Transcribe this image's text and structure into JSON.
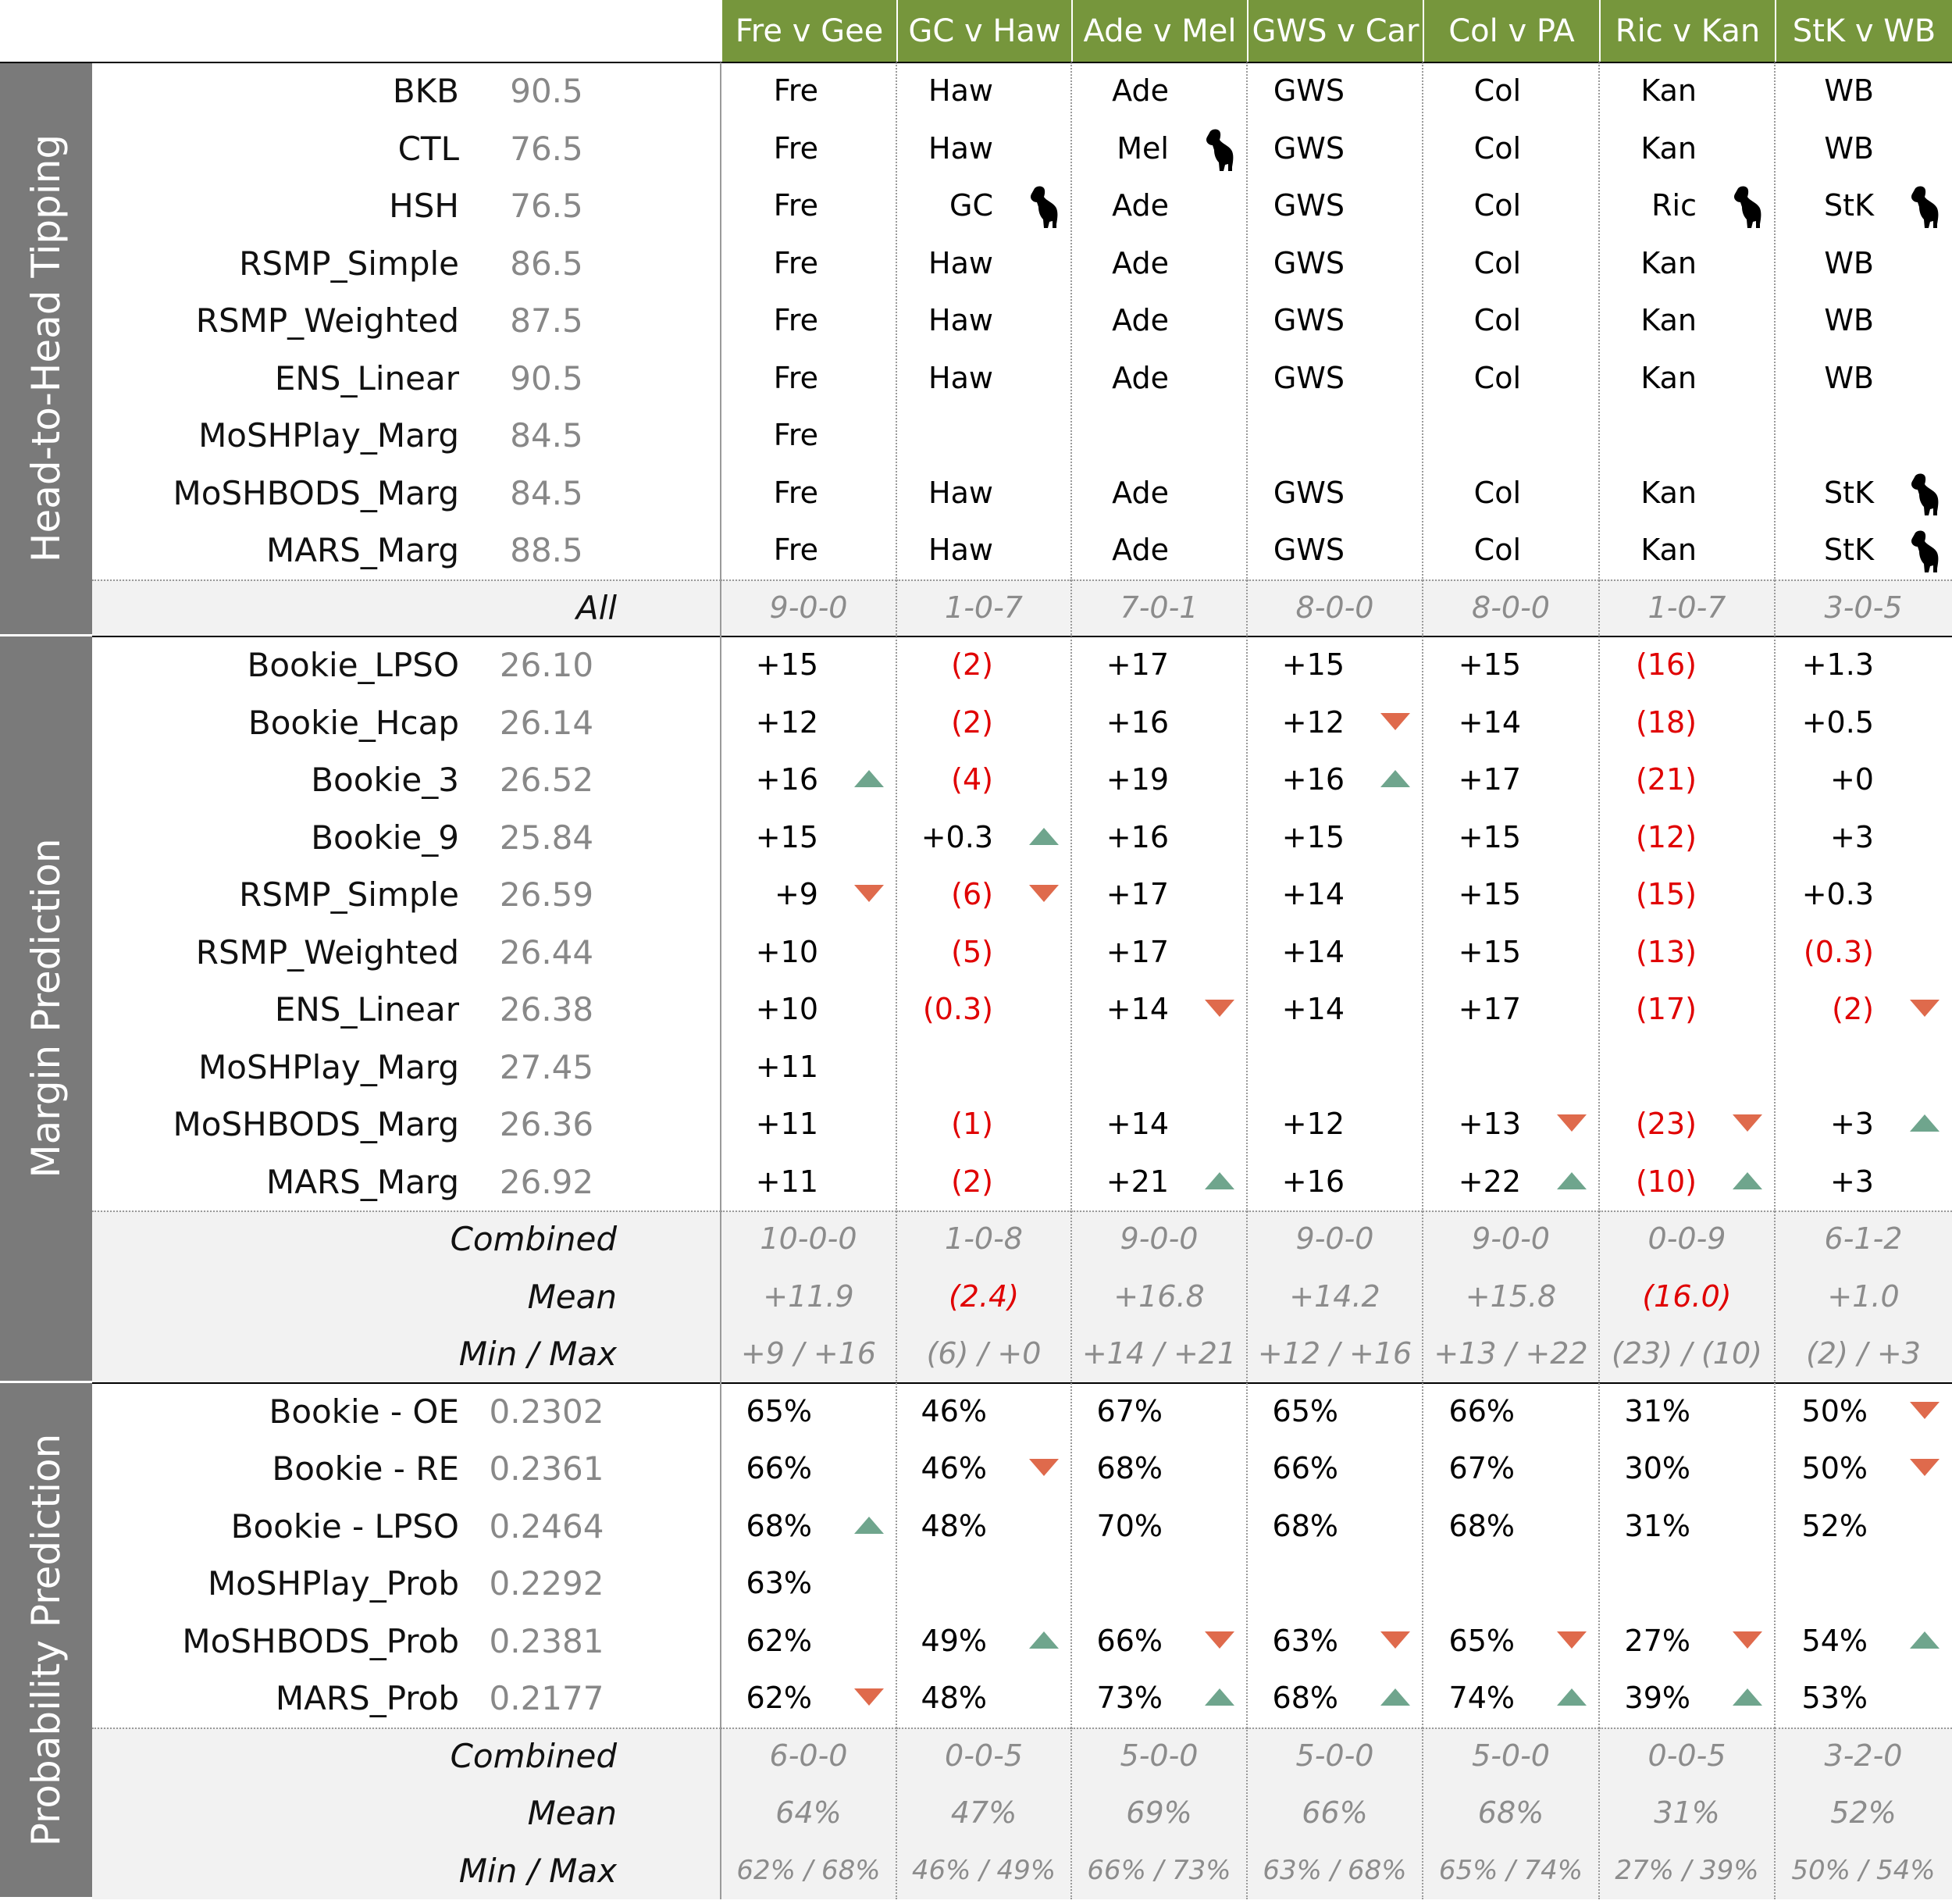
{
  "columns": [
    "Fre v Gee",
    "GC v Haw",
    "Ade v Mel",
    "GWS v Car",
    "Col v PA",
    "Ric v Kan",
    "StK v WB"
  ],
  "icons": {
    "dog": "dog-icon",
    "up": "triangle-up-icon",
    "down": "triangle-down-icon"
  },
  "colors": {
    "header_green": "#76963c",
    "section_grey": "#7a7a7a",
    "negative_red": "#e00000",
    "up_arrow": "#6fa58d",
    "down_arrow": "#df6a4c"
  },
  "sections": [
    {
      "title": "Head-to-Head Tipping",
      "rows": [
        {
          "label": "BKB",
          "score": "90.5",
          "cells": [
            {
              "v": "Fre"
            },
            {
              "v": "Haw"
            },
            {
              "v": "Ade"
            },
            {
              "v": "GWS"
            },
            {
              "v": "Col"
            },
            {
              "v": "Kan"
            },
            {
              "v": "WB"
            }
          ]
        },
        {
          "label": "CTL",
          "score": "76.5",
          "cells": [
            {
              "v": "Fre"
            },
            {
              "v": "Haw"
            },
            {
              "v": "Mel",
              "mark": "dog"
            },
            {
              "v": "GWS"
            },
            {
              "v": "Col"
            },
            {
              "v": "Kan"
            },
            {
              "v": "WB"
            }
          ]
        },
        {
          "label": "HSH",
          "score": "76.5",
          "cells": [
            {
              "v": "Fre"
            },
            {
              "v": "GC",
              "mark": "dog"
            },
            {
              "v": "Ade"
            },
            {
              "v": "GWS"
            },
            {
              "v": "Col"
            },
            {
              "v": "Ric",
              "mark": "dog"
            },
            {
              "v": "StK",
              "mark": "dog"
            }
          ]
        },
        {
          "label": "RSMP_Simple",
          "score": "86.5",
          "cells": [
            {
              "v": "Fre"
            },
            {
              "v": "Haw"
            },
            {
              "v": "Ade"
            },
            {
              "v": "GWS"
            },
            {
              "v": "Col"
            },
            {
              "v": "Kan"
            },
            {
              "v": "WB"
            }
          ]
        },
        {
          "label": "RSMP_Weighted",
          "score": "87.5",
          "cells": [
            {
              "v": "Fre"
            },
            {
              "v": "Haw"
            },
            {
              "v": "Ade"
            },
            {
              "v": "GWS"
            },
            {
              "v": "Col"
            },
            {
              "v": "Kan"
            },
            {
              "v": "WB"
            }
          ]
        },
        {
          "label": "ENS_Linear",
          "score": "90.5",
          "cells": [
            {
              "v": "Fre"
            },
            {
              "v": "Haw"
            },
            {
              "v": "Ade"
            },
            {
              "v": "GWS"
            },
            {
              "v": "Col"
            },
            {
              "v": "Kan"
            },
            {
              "v": "WB"
            }
          ]
        },
        {
          "label": "MoSHPlay_Marg",
          "score": "84.5",
          "cells": [
            {
              "v": "Fre"
            },
            {
              "v": ""
            },
            {
              "v": ""
            },
            {
              "v": ""
            },
            {
              "v": ""
            },
            {
              "v": ""
            },
            {
              "v": ""
            }
          ]
        },
        {
          "label": "MoSHBODS_Marg",
          "score": "84.5",
          "cells": [
            {
              "v": "Fre"
            },
            {
              "v": "Haw"
            },
            {
              "v": "Ade"
            },
            {
              "v": "GWS"
            },
            {
              "v": "Col"
            },
            {
              "v": "Kan"
            },
            {
              "v": "StK",
              "mark": "dog"
            }
          ]
        },
        {
          "label": "MARS_Marg",
          "score": "88.5",
          "cells": [
            {
              "v": "Fre"
            },
            {
              "v": "Haw"
            },
            {
              "v": "Ade"
            },
            {
              "v": "GWS"
            },
            {
              "v": "Col"
            },
            {
              "v": "Kan"
            },
            {
              "v": "StK",
              "mark": "dog"
            }
          ]
        }
      ],
      "summary": [
        {
          "label": "All",
          "values": [
            {
              "v": "9-0-0"
            },
            {
              "v": "1-0-7"
            },
            {
              "v": "7-0-1"
            },
            {
              "v": "8-0-0"
            },
            {
              "v": "8-0-0"
            },
            {
              "v": "1-0-7"
            },
            {
              "v": "3-0-5"
            }
          ]
        }
      ]
    },
    {
      "title": "Margin Prediction",
      "rows": [
        {
          "label": "Bookie_LPSO",
          "score": "26.10",
          "cells": [
            {
              "v": "+15"
            },
            {
              "v": "(2)"
            },
            {
              "v": "+17"
            },
            {
              "v": "+15"
            },
            {
              "v": "+15"
            },
            {
              "v": "(16)"
            },
            {
              "v": "+1.3"
            }
          ]
        },
        {
          "label": "Bookie_Hcap",
          "score": "26.14",
          "cells": [
            {
              "v": "+12"
            },
            {
              "v": "(2)"
            },
            {
              "v": "+16"
            },
            {
              "v": "+12",
              "mark": "down"
            },
            {
              "v": "+14"
            },
            {
              "v": "(18)"
            },
            {
              "v": "+0.5"
            }
          ]
        },
        {
          "label": "Bookie_3",
          "score": "26.52",
          "cells": [
            {
              "v": "+16",
              "mark": "up"
            },
            {
              "v": "(4)"
            },
            {
              "v": "+19"
            },
            {
              "v": "+16",
              "mark": "up"
            },
            {
              "v": "+17"
            },
            {
              "v": "(21)"
            },
            {
              "v": "+0"
            }
          ]
        },
        {
          "label": "Bookie_9",
          "score": "25.84",
          "cells": [
            {
              "v": "+15"
            },
            {
              "v": "+0.3",
              "mark": "up"
            },
            {
              "v": "+16"
            },
            {
              "v": "+15"
            },
            {
              "v": "+15"
            },
            {
              "v": "(12)"
            },
            {
              "v": "+3"
            }
          ]
        },
        {
          "label": "RSMP_Simple",
          "score": "26.59",
          "cells": [
            {
              "v": "+9",
              "mark": "down"
            },
            {
              "v": "(6)",
              "mark": "down"
            },
            {
              "v": "+17"
            },
            {
              "v": "+14"
            },
            {
              "v": "+15"
            },
            {
              "v": "(15)"
            },
            {
              "v": "+0.3"
            }
          ]
        },
        {
          "label": "RSMP_Weighted",
          "score": "26.44",
          "cells": [
            {
              "v": "+10"
            },
            {
              "v": "(5)"
            },
            {
              "v": "+17"
            },
            {
              "v": "+14"
            },
            {
              "v": "+15"
            },
            {
              "v": "(13)"
            },
            {
              "v": "(0.3)"
            }
          ]
        },
        {
          "label": "ENS_Linear",
          "score": "26.38",
          "cells": [
            {
              "v": "+10"
            },
            {
              "v": "(0.3)"
            },
            {
              "v": "+14",
              "mark": "down"
            },
            {
              "v": "+14"
            },
            {
              "v": "+17"
            },
            {
              "v": "(17)"
            },
            {
              "v": "(2)",
              "mark": "down"
            }
          ]
        },
        {
          "label": "MoSHPlay_Marg",
          "score": "27.45",
          "cells": [
            {
              "v": "+11"
            },
            {
              "v": ""
            },
            {
              "v": ""
            },
            {
              "v": ""
            },
            {
              "v": ""
            },
            {
              "v": ""
            },
            {
              "v": ""
            }
          ]
        },
        {
          "label": "MoSHBODS_Marg",
          "score": "26.36",
          "cells": [
            {
              "v": "+11"
            },
            {
              "v": "(1)"
            },
            {
              "v": "+14"
            },
            {
              "v": "+12"
            },
            {
              "v": "+13",
              "mark": "down"
            },
            {
              "v": "(23)",
              "mark": "down"
            },
            {
              "v": "+3",
              "mark": "up"
            }
          ]
        },
        {
          "label": "MARS_Marg",
          "score": "26.92",
          "cells": [
            {
              "v": "+11"
            },
            {
              "v": "(2)"
            },
            {
              "v": "+21",
              "mark": "up"
            },
            {
              "v": "+16"
            },
            {
              "v": "+22",
              "mark": "up"
            },
            {
              "v": "(10)",
              "mark": "up"
            },
            {
              "v": "+3"
            }
          ]
        }
      ],
      "summary": [
        {
          "label": "Combined",
          "values": [
            {
              "v": "10-0-0"
            },
            {
              "v": "1-0-8"
            },
            {
              "v": "9-0-0"
            },
            {
              "v": "9-0-0"
            },
            {
              "v": "9-0-0"
            },
            {
              "v": "0-0-9"
            },
            {
              "v": "6-1-2"
            }
          ]
        },
        {
          "label": "Mean",
          "values": [
            {
              "v": "+11.9"
            },
            {
              "v": "(2.4)"
            },
            {
              "v": "+16.8"
            },
            {
              "v": "+14.2"
            },
            {
              "v": "+15.8"
            },
            {
              "v": "(16.0)"
            },
            {
              "v": "+1.0"
            }
          ]
        },
        {
          "label": "Min / Max",
          "values": [
            {
              "v": "+9 / +16"
            },
            {
              "v": "(6) / +0"
            },
            {
              "v": "+14 / +21"
            },
            {
              "v": "+12 / +16"
            },
            {
              "v": "+13 / +22"
            },
            {
              "v": "(23) / (10)"
            },
            {
              "v": "(2) / +3"
            }
          ]
        }
      ]
    },
    {
      "title": "Probability Prediction",
      "rows": [
        {
          "label": "Bookie - OE",
          "score": "0.2302",
          "cells": [
            {
              "v": "65%"
            },
            {
              "v": "46%"
            },
            {
              "v": "67%"
            },
            {
              "v": "65%"
            },
            {
              "v": "66%"
            },
            {
              "v": "31%"
            },
            {
              "v": "50%",
              "mark": "down"
            }
          ]
        },
        {
          "label": "Bookie - RE",
          "score": "0.2361",
          "cells": [
            {
              "v": "66%"
            },
            {
              "v": "46%",
              "mark": "down"
            },
            {
              "v": "68%"
            },
            {
              "v": "66%"
            },
            {
              "v": "67%"
            },
            {
              "v": "30%"
            },
            {
              "v": "50%",
              "mark": "down"
            }
          ]
        },
        {
          "label": "Bookie - LPSO",
          "score": "0.2464",
          "cells": [
            {
              "v": "68%",
              "mark": "up"
            },
            {
              "v": "48%"
            },
            {
              "v": "70%"
            },
            {
              "v": "68%"
            },
            {
              "v": "68%"
            },
            {
              "v": "31%"
            },
            {
              "v": "52%"
            }
          ]
        },
        {
          "label": "MoSHPlay_Prob",
          "score": "0.2292",
          "cells": [
            {
              "v": "63%"
            },
            {
              "v": ""
            },
            {
              "v": ""
            },
            {
              "v": ""
            },
            {
              "v": ""
            },
            {
              "v": ""
            },
            {
              "v": ""
            }
          ]
        },
        {
          "label": "MoSHBODS_Prob",
          "score": "0.2381",
          "cells": [
            {
              "v": "62%"
            },
            {
              "v": "49%",
              "mark": "up"
            },
            {
              "v": "66%",
              "mark": "down"
            },
            {
              "v": "63%",
              "mark": "down"
            },
            {
              "v": "65%",
              "mark": "down"
            },
            {
              "v": "27%",
              "mark": "down"
            },
            {
              "v": "54%",
              "mark": "up"
            }
          ]
        },
        {
          "label": "MARS_Prob",
          "score": "0.2177",
          "cells": [
            {
              "v": "62%",
              "mark": "down"
            },
            {
              "v": "48%"
            },
            {
              "v": "73%",
              "mark": "up"
            },
            {
              "v": "68%",
              "mark": "up"
            },
            {
              "v": "74%",
              "mark": "up"
            },
            {
              "v": "39%",
              "mark": "up"
            },
            {
              "v": "53%"
            }
          ]
        }
      ],
      "summary": [
        {
          "label": "Combined",
          "values": [
            {
              "v": "6-0-0"
            },
            {
              "v": "0-0-5"
            },
            {
              "v": "5-0-0"
            },
            {
              "v": "5-0-0"
            },
            {
              "v": "5-0-0"
            },
            {
              "v": "0-0-5"
            },
            {
              "v": "3-2-0"
            }
          ]
        },
        {
          "label": "Mean",
          "values": [
            {
              "v": "64%"
            },
            {
              "v": "47%"
            },
            {
              "v": "69%"
            },
            {
              "v": "66%"
            },
            {
              "v": "68%"
            },
            {
              "v": "31%"
            },
            {
              "v": "52%"
            }
          ]
        },
        {
          "label": "Min / Max",
          "values": [
            {
              "v": "62% / 68%"
            },
            {
              "v": "46% / 49%"
            },
            {
              "v": "66% / 73%"
            },
            {
              "v": "63% / 68%"
            },
            {
              "v": "65% / 74%"
            },
            {
              "v": "27% / 39%"
            },
            {
              "v": "50% / 54%"
            }
          ]
        }
      ]
    }
  ]
}
